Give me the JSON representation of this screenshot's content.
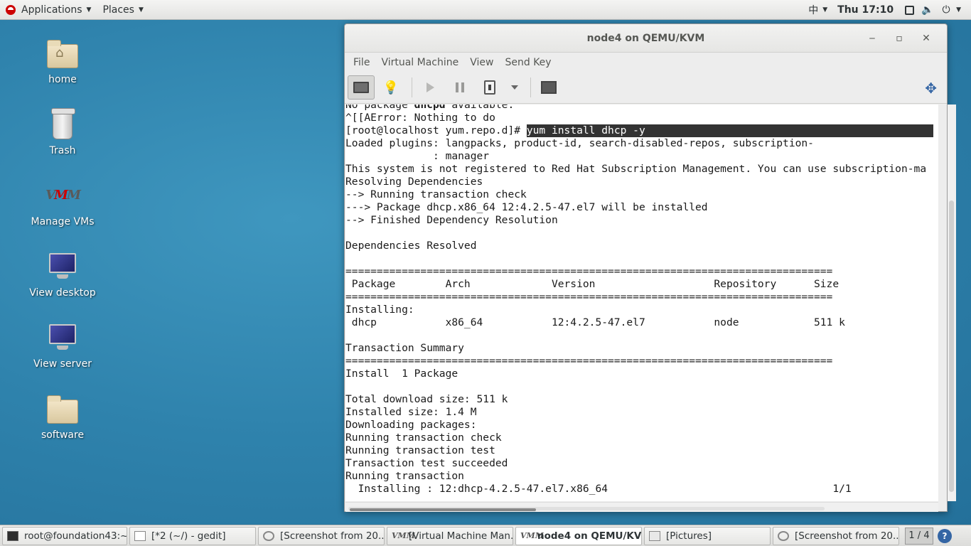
{
  "top_panel": {
    "applications": "Applications",
    "places": "Places",
    "input_method": "中",
    "clock": "Thu 17:10"
  },
  "desktop_icons": [
    {
      "label": "home"
    },
    {
      "label": "Trash"
    },
    {
      "label": "Manage VMs"
    },
    {
      "label": "View desktop"
    },
    {
      "label": "View server"
    },
    {
      "label": "software"
    }
  ],
  "vm_window": {
    "title": "node4 on QEMU/KVM",
    "menu": [
      "File",
      "Virtual Machine",
      "View",
      "Send Key"
    ]
  },
  "console": {
    "lines": [
      {
        "text": "No package dhcpd available."
      },
      {
        "text": "^[[AError: Nothing to do"
      },
      {
        "prompt": "[root@localhost yum.repo.d]# ",
        "command": "yum install dhcp -y"
      },
      {
        "text": "Loaded plugins: langpacks, product-id, search-disabled-repos, subscription-"
      },
      {
        "text": "              : manager"
      },
      {
        "text": "This system is not registered to Red Hat Subscription Management. You can use subscription-ma"
      },
      {
        "text": "Resolving Dependencies"
      },
      {
        "text": "--> Running transaction check"
      },
      {
        "text": "---> Package dhcp.x86_64 12:4.2.5-47.el7 will be installed"
      },
      {
        "text": "--> Finished Dependency Resolution"
      },
      {
        "text": ""
      },
      {
        "text": "Dependencies Resolved"
      },
      {
        "text": ""
      },
      {
        "text": "=============================================================================="
      },
      {
        "text": " Package        Arch             Version                   Repository      Size"
      },
      {
        "text": "=============================================================================="
      },
      {
        "text": "Installing:"
      },
      {
        "text": " dhcp           x86_64           12:4.2.5-47.el7           node            511 k"
      },
      {
        "text": ""
      },
      {
        "text": "Transaction Summary"
      },
      {
        "text": "=============================================================================="
      },
      {
        "text": "Install  1 Package"
      },
      {
        "text": ""
      },
      {
        "text": "Total download size: 511 k"
      },
      {
        "text": "Installed size: 1.4 M"
      },
      {
        "text": "Downloading packages:"
      },
      {
        "text": "Running transaction check"
      },
      {
        "text": "Running transaction test"
      },
      {
        "text": "Transaction test succeeded"
      },
      {
        "text": "Running transaction"
      },
      {
        "text": "  Installing : 12:dhcp-4.2.5-47.el7.x86_64                                    1/1"
      }
    ]
  },
  "taskbar": {
    "tasks": [
      {
        "label": "root@foundation43:~",
        "icon": "terminal-icon"
      },
      {
        "label": "[*2 (~/) - gedit]",
        "icon": "text-editor-icon"
      },
      {
        "label": "[Screenshot from 20...",
        "icon": "screenshot-icon"
      },
      {
        "label": "[Virtual Machine Man...",
        "icon": "vm-manager-icon"
      },
      {
        "label": "node4 on QEMU/KVM",
        "icon": "vm-manager-icon",
        "active": true
      },
      {
        "label": "[Pictures]",
        "icon": "folder-icon"
      },
      {
        "label": "[Screenshot from 20...",
        "icon": "screenshot-icon"
      }
    ],
    "pager": "1 / 4"
  }
}
